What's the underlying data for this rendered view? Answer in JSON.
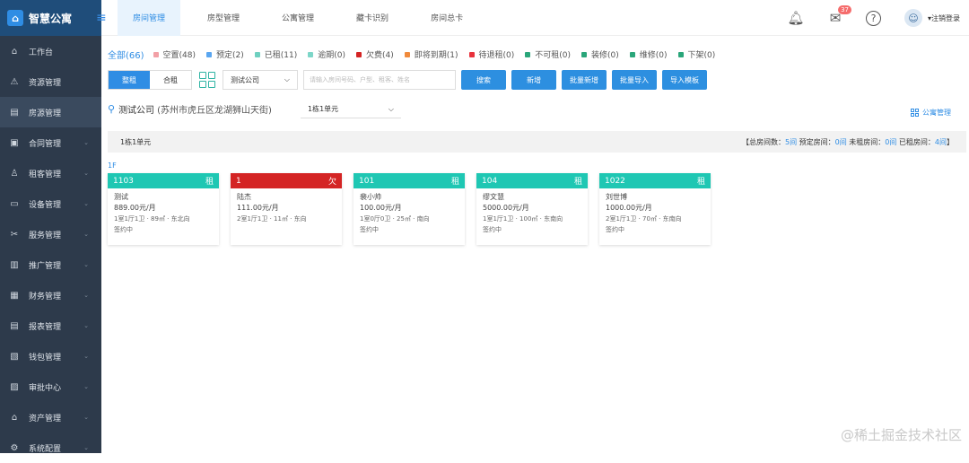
{
  "brand": {
    "title": "智慧公寓"
  },
  "nav": [
    {
      "label": "工作台",
      "icon": "home-icon"
    },
    {
      "label": "资源管理",
      "icon": "warning-icon"
    },
    {
      "label": "房源管理",
      "icon": "document-icon",
      "active": true
    },
    {
      "label": "合同管理",
      "icon": "contract-icon"
    },
    {
      "label": "租客管理",
      "icon": "tenant-icon"
    },
    {
      "label": "设备管理",
      "icon": "device-icon"
    },
    {
      "label": "服务管理",
      "icon": "tools-icon"
    },
    {
      "label": "推广管理",
      "icon": "promotion-icon"
    },
    {
      "label": "财务管理",
      "icon": "finance-icon"
    },
    {
      "label": "报表管理",
      "icon": "report-icon"
    },
    {
      "label": "钱包管理",
      "icon": "wallet-icon"
    },
    {
      "label": "审批中心",
      "icon": "approval-icon"
    },
    {
      "label": "资产管理",
      "icon": "asset-icon"
    },
    {
      "label": "系统配置",
      "icon": "settings-icon"
    }
  ],
  "tabs": [
    {
      "label": "房间管理",
      "active": true
    },
    {
      "label": "房型管理"
    },
    {
      "label": "公寓管理"
    },
    {
      "label": "藏卡识别"
    },
    {
      "label": "房间总卡"
    }
  ],
  "header": {
    "mail_badge": "37",
    "logout": "注销登录"
  },
  "filters": {
    "all": "全部(66)",
    "items": [
      {
        "label": "空置(48)",
        "color": "#f2a0a6"
      },
      {
        "label": "预定(2)",
        "color": "#5aa6f0"
      },
      {
        "label": "已租(11)",
        "color": "#6fd0c0"
      },
      {
        "label": "逾期(0)",
        "color": "#7dd6c8"
      },
      {
        "label": "欠费(4)",
        "color": "#d42424"
      },
      {
        "label": "即将到期(1)",
        "color": "#f08a3c"
      },
      {
        "label": "待退租(0)",
        "color": "#e8323c"
      },
      {
        "label": "不可租(0)",
        "color": "#2aa67a"
      },
      {
        "label": "装修(0)",
        "color": "#2aa67a"
      },
      {
        "label": "维修(0)",
        "color": "#2aa67a"
      },
      {
        "label": "下架(0)",
        "color": "#2aa67a"
      }
    ]
  },
  "toolbar": {
    "whole": "整租",
    "shared": "合租",
    "company": "测试公司",
    "search_placeholder": "请输入房间号码、户型、租客、姓名",
    "buttons": [
      "搜索",
      "新增",
      "批量新增",
      "批量导入",
      "导入模板"
    ]
  },
  "location": {
    "name": "测试公司",
    "addr": "(苏州市虎丘区龙湖狮山天街)",
    "unit": "1栋1单元",
    "apartment_mgmt": "公寓管理"
  },
  "summary": {
    "unit": "1栋1单元",
    "open": "【总房间数：",
    "total": "5间",
    "reserved_label": "预定房间：",
    "reserved": "0间",
    "unrented_label": "未租房间：",
    "unrented": "0间",
    "rented_label": "已租房间：",
    "rented": "4间",
    "close": "】"
  },
  "floor": "1F",
  "rooms": [
    {
      "no": "1103",
      "tag": "租",
      "color": "#1fc7b3",
      "tenant": "测试",
      "price": "889.00元/月",
      "spec": "1室1厅1卫 · 89㎡ · 东北向",
      "status": "签约中"
    },
    {
      "no": "1",
      "tag": "欠",
      "color": "#d42424",
      "tenant": "陆杰",
      "price": "111.00元/月",
      "spec": "2室1厅1卫 · 11㎡ · 东向",
      "status": ""
    },
    {
      "no": "101",
      "tag": "租",
      "color": "#1fc7b3",
      "tenant": "裴小帅",
      "price": "100.00元/月",
      "spec": "1室0厅0卫 · 25㎡ · 南向",
      "status": "签约中"
    },
    {
      "no": "104",
      "tag": "租",
      "color": "#1fc7b3",
      "tenant": "缪文慧",
      "price": "5000.00元/月",
      "spec": "1室1厅1卫 · 100㎡ · 东南向",
      "status": "签约中"
    },
    {
      "no": "1022",
      "tag": "租",
      "color": "#1fc7b3",
      "tenant": "刘世博",
      "price": "1000.00元/月",
      "spec": "2室1厅1卫 · 70㎡ · 东南向",
      "status": "签约中"
    }
  ],
  "watermark": "@稀土掘金技术社区"
}
